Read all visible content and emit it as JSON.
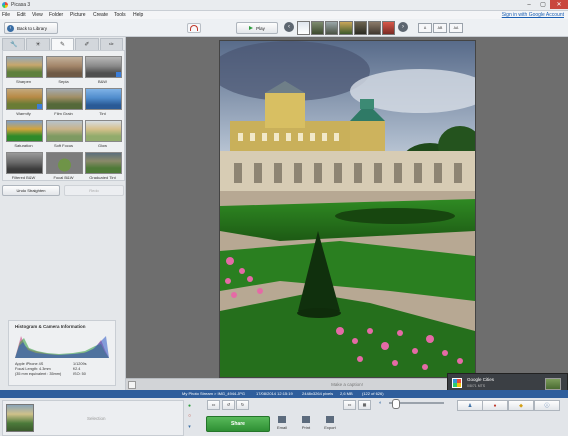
{
  "window": {
    "title": "Picasa 3",
    "controls": [
      "–",
      "▢",
      "✕"
    ]
  },
  "menu": {
    "items": [
      "File",
      "Edit",
      "View",
      "Folder",
      "Picture",
      "Create",
      "Tools",
      "Help"
    ],
    "sign_in": "Sign in with Google Account"
  },
  "toolbar": {
    "back_label": "Back to Library",
    "play_label": "Play",
    "view_modes": [
      "A",
      "AB",
      "AA"
    ]
  },
  "edit_tabs": [
    "wrench-icon",
    "sun-icon",
    "brush-icon",
    "paint-icon",
    "paint-bucket-icon"
  ],
  "effects": [
    {
      "label": "Sharpen",
      "tone": "#6f8a4e"
    },
    {
      "label": "Sepia",
      "tone": "#a38364"
    },
    {
      "label": "B&W",
      "tone": "#7d7d7d"
    },
    {
      "label": "Warmify",
      "tone": "#b3874d"
    },
    {
      "label": "Film Grain",
      "tone": "#6f7a5a"
    },
    {
      "label": "Tint",
      "tone": "#4a7db8"
    },
    {
      "label": "Saturation",
      "tone": "#4f9a3a"
    },
    {
      "label": "Soft Focus",
      "tone": "#8ea47a"
    },
    {
      "label": "Glow",
      "tone": "#9cb07e"
    },
    {
      "label": "Filtered B&W",
      "tone": "#5d5d5d"
    },
    {
      "label": "Focal B&W",
      "tone": "#6a7a54"
    },
    {
      "label": "Graduated Tint",
      "tone": "#6d8a5a"
    }
  ],
  "buttons": {
    "undo": "Undo Straighten",
    "redo": "Redo"
  },
  "histogram": {
    "title": "Histogram & Camera Information",
    "camera_left": [
      "Apple iPhone 4S",
      "Focal Length: 4.3mm",
      "(35 mm equivalent : 35mm)"
    ],
    "camera_right": [
      "1/1209s",
      "f/2.4",
      "ISO: 50"
    ]
  },
  "caption": {
    "placeholder": "Make a caption!"
  },
  "google_card": {
    "title": "Google Cities",
    "subtitle": "0/8/71 MTS"
  },
  "status": {
    "path": "My Photo Stream > IMG_4944.JPG",
    "date": "17/08/2014 12:15:19",
    "dims": "2448x3264 pixels",
    "size": "2,6 MB",
    "count": "(122 of 626)"
  },
  "tray": {
    "selection_label": "Selection",
    "share_label": "Share",
    "actions": [
      "Email",
      "Print",
      "Export"
    ]
  },
  "colors": {
    "statusbar": "#2f5e9c",
    "share": "#3ea243",
    "signin": "#1a5fb4"
  }
}
